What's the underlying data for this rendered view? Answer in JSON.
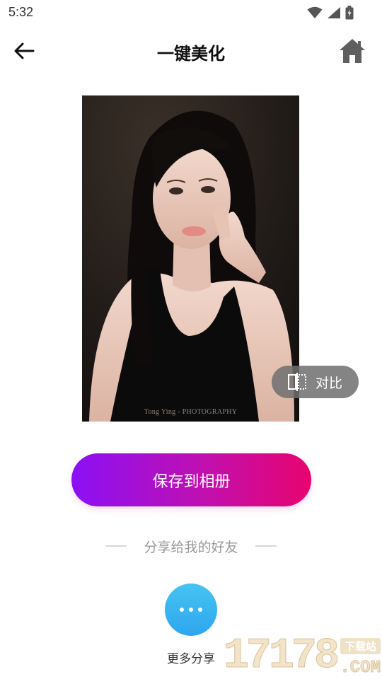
{
  "status_bar": {
    "time": "5:32",
    "icons": [
      "wifi-icon",
      "cell-signal-icon",
      "battery-charging-icon"
    ]
  },
  "header": {
    "title": "一键美化",
    "back_icon": "arrow-left-icon",
    "home_icon": "home-icon"
  },
  "photo": {
    "watermark": "Tong Ying - PHOTOGRAPHY"
  },
  "compare_button": {
    "label": "对比",
    "icon": "compare-icon"
  },
  "save_button": {
    "label": "保存到相册",
    "gradient": [
      "#8b10f5",
      "#e8046e"
    ]
  },
  "share": {
    "heading": "分享给我的好友",
    "more_label": "更多分享",
    "more_icon": "more-dots-icon",
    "accent": "#35b0f0"
  },
  "watermark": {
    "digits": "17178",
    "tag": "下载站",
    "suffix": ".COM"
  }
}
